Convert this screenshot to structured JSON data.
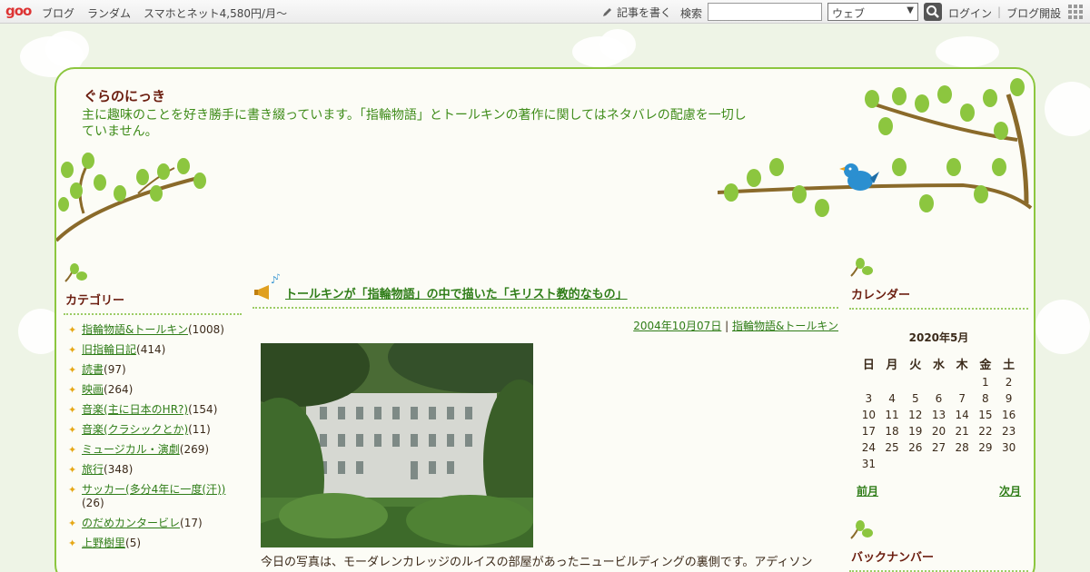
{
  "toolbar": {
    "logo": "goo",
    "nav": [
      "ブログ",
      "ランダム",
      "スマホとネット4,580円/月～"
    ],
    "write_label": "記事を書く",
    "search_label": "検索",
    "search_value": "",
    "search_scope": "ウェブ",
    "login": "ログイン",
    "open_blog": "ブログ開設"
  },
  "blog": {
    "title": "ぐらのにっき",
    "description": "主に趣味のことを好き勝手に書き綴っています。「指輪物語」とトールキンの著作に関してはネタバレの配慮を一切していません。"
  },
  "sidebar_left": {
    "heading": "カテゴリー",
    "categories": [
      {
        "name": "指輪物語&トールキン",
        "count": "(1008)"
      },
      {
        "name": "旧指輪日記",
        "count": "(414)"
      },
      {
        "name": "読書",
        "count": "(97)"
      },
      {
        "name": "映画",
        "count": "(264)"
      },
      {
        "name": "音楽(主に日本のHR?)",
        "count": "(154)"
      },
      {
        "name": "音楽(クラシックとか)",
        "count": "(11)"
      },
      {
        "name": "ミュージカル・演劇",
        "count": "(269)"
      },
      {
        "name": "旅行",
        "count": "(348)"
      },
      {
        "name": "サッカー(多分4年に一度(汗))",
        "count": "(26)"
      },
      {
        "name": "のだめカンタービレ",
        "count": "(17)"
      },
      {
        "name": "上野樹里",
        "count": "(5)"
      }
    ]
  },
  "post": {
    "title": "トールキンが「指輪物語」の中で描いた「キリスト教的なもの」",
    "date": "2004年10月07日",
    "separator": " | ",
    "category": "指輪物語&トールキン",
    "body": "今日の写真は、モーダレンカレッジのルイスの部屋があったニュービルディングの裏側です。アディソン"
  },
  "sidebar_right": {
    "calendar_heading": "カレンダー",
    "month": "2020年5月",
    "weekdays": [
      "日",
      "月",
      "火",
      "水",
      "木",
      "金",
      "土"
    ],
    "weeks": [
      [
        "",
        "",
        "",
        "",
        "",
        "1",
        "2"
      ],
      [
        "3",
        "4",
        "5",
        "6",
        "7",
        "8",
        "9"
      ],
      [
        "10",
        "11",
        "12",
        "13",
        "14",
        "15",
        "16"
      ],
      [
        "17",
        "18",
        "19",
        "20",
        "21",
        "22",
        "23"
      ],
      [
        "24",
        "25",
        "26",
        "27",
        "28",
        "29",
        "30"
      ],
      [
        "31",
        "",
        "",
        "",
        "",
        "",
        ""
      ]
    ],
    "prev": "前月",
    "next": "次月",
    "backnumber_heading": "バックナンバー"
  },
  "colors": {
    "accent_green": "#8cc63f",
    "link_green": "#2f7d18",
    "title_brown": "#6b1d0f"
  }
}
